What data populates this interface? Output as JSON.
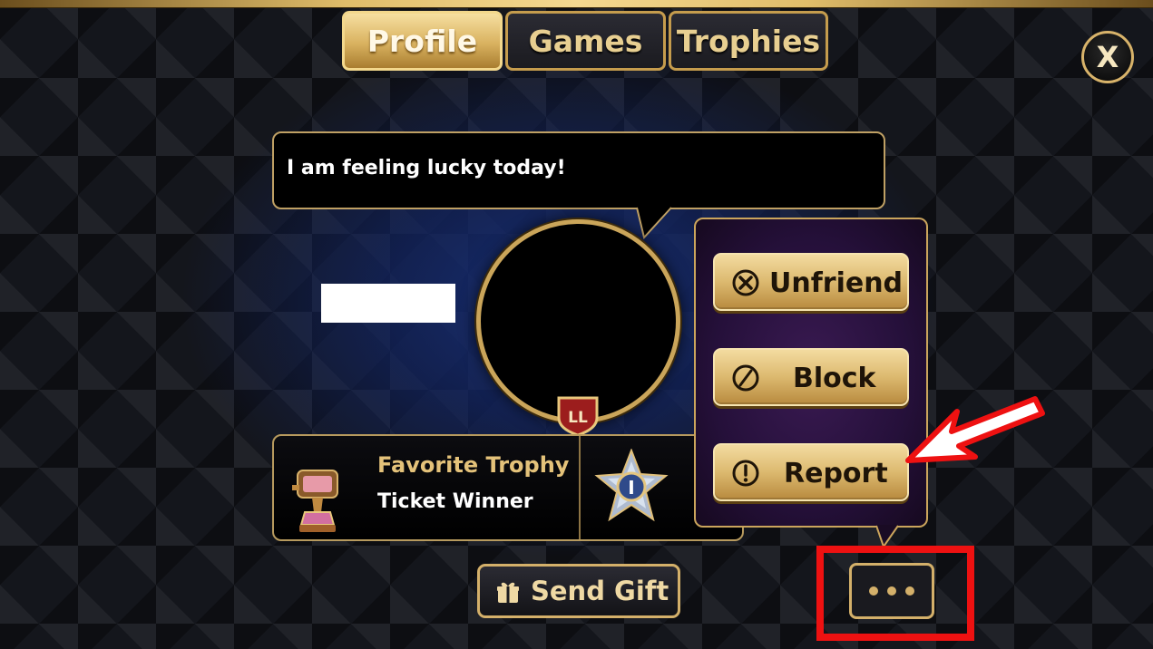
{
  "tabs": [
    {
      "label": "Profile",
      "active": true
    },
    {
      "label": "Games",
      "active": false
    },
    {
      "label": "Trophies",
      "active": false
    }
  ],
  "close": {
    "label": "X"
  },
  "status_message": "I am feeling lucky today!",
  "rank_badge": {
    "label": "LL"
  },
  "favorite_trophy": {
    "title": "Favorite Trophy",
    "name": "Ticket Winner",
    "icon": "trophy-cup-icon"
  },
  "level_badge": {
    "icon": "star-badge-icon",
    "label": "I"
  },
  "menu": {
    "items": [
      {
        "label": "Unfriend",
        "icon": "unfriend-x-icon"
      },
      {
        "label": "Block",
        "icon": "block-icon"
      },
      {
        "label": "Report",
        "icon": "report-exclamation-icon"
      }
    ]
  },
  "footer": {
    "send_gift_label": "Send Gift",
    "send_gift_icon": "gift-icon",
    "more_icon": "more-dots-icon"
  },
  "colors": {
    "gold": "#d4b06a",
    "gold_light": "#f3dba0",
    "popup_purple": "#2a1240",
    "highlight_red": "#ee1111",
    "background_blue": "#183078"
  }
}
